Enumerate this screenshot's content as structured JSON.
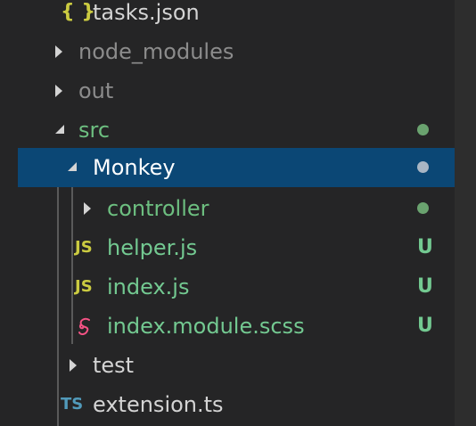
{
  "colors": {
    "background": "#252526",
    "selection": "#0b4775",
    "git_modified_green": "#6dbf80",
    "git_untracked_green": "#73c991",
    "dim_text": "#8c8c8c",
    "normal_text": "#cccccc",
    "dot_green": "#6aa36f",
    "dot_selected": "#a9b6c4",
    "js_yellow": "#cbcb41",
    "ts_blue": "#519aba",
    "scss_pink": "#f55385"
  },
  "tree": {
    "tasks_json": {
      "icon": "{ }",
      "label": "tasks.json"
    },
    "node_modules": {
      "label": "node_modules"
    },
    "out": {
      "label": "out"
    },
    "src": {
      "label": "src"
    },
    "monkey": {
      "label": "Monkey"
    },
    "controller": {
      "label": "controller"
    },
    "helper_js": {
      "icon": "JS",
      "label": "helper.js",
      "badge": "U"
    },
    "index_js": {
      "icon": "JS",
      "label": "index.js",
      "badge": "U"
    },
    "index_module_scss": {
      "icon": "scss-icon",
      "label": "index.module.scss",
      "badge": "U"
    },
    "test": {
      "label": "test"
    },
    "extension_ts": {
      "icon": "TS",
      "label": "extension.ts"
    }
  }
}
